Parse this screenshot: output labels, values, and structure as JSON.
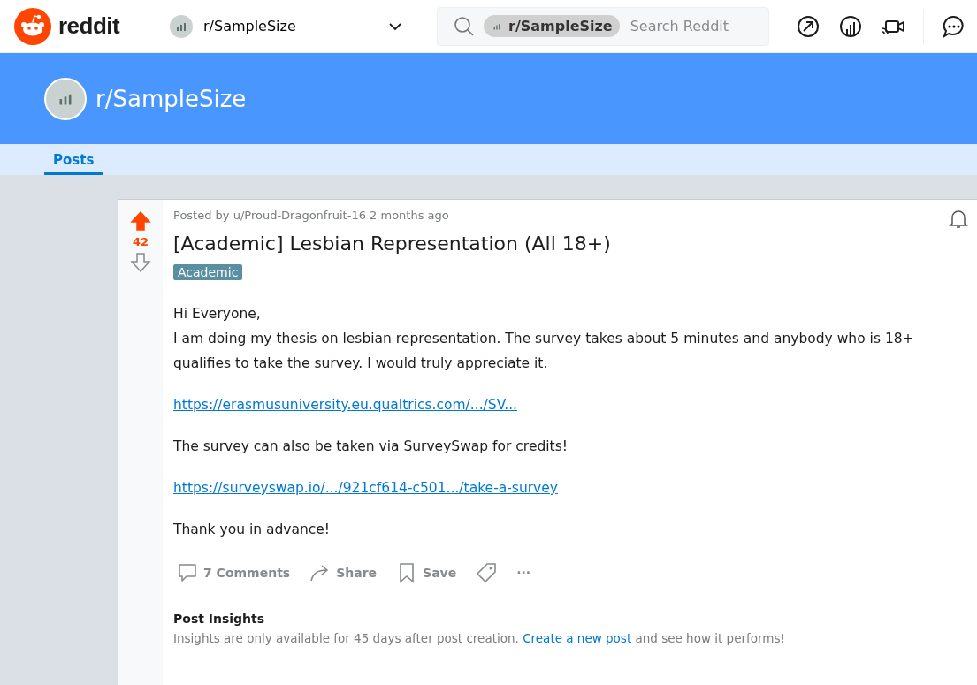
{
  "header": {
    "brand": "reddit",
    "community": "r/SampleSize",
    "search_chip": "r/SampleSize",
    "search_placeholder": "Search Reddit"
  },
  "banner": {
    "title": "r/SampleSize"
  },
  "tabs": [
    {
      "label": "Posts",
      "selected": true
    }
  ],
  "post": {
    "meta": "Posted by u/Proud-Dragonfruit-16 2 months ago",
    "score": "42",
    "upvoted": true,
    "title": "[Academic] Lesbian Representation (All 18+)",
    "flair": "Academic",
    "body": [
      {
        "kind": "text",
        "lines": [
          "Hi Everyone,",
          "I am doing my thesis on lesbian representation. The survey takes about 5 minutes and anybody who is 18+ qualifies to take the survey. I would truly appreciate it."
        ]
      },
      {
        "kind": "link",
        "lines": [
          "https://erasmusuniversity.eu.qualtrics.com/.../SV..."
        ]
      },
      {
        "kind": "text",
        "lines": [
          "The survey can also be taken via SurveySwap for credits!"
        ]
      },
      {
        "kind": "link",
        "lines": [
          "https://surveyswap.io/.../921cf614-c501.../take-a-survey"
        ]
      },
      {
        "kind": "text",
        "lines": [
          "Thank you in advance!"
        ]
      }
    ],
    "actions": [
      {
        "kind": "comments",
        "label": "7 Comments"
      },
      {
        "kind": "share",
        "label": "Share"
      },
      {
        "kind": "save",
        "label": "Save"
      },
      {
        "kind": "tag"
      },
      {
        "kind": "more",
        "label": "···"
      }
    ],
    "insights": {
      "title": "Post Insights",
      "text_before": "Insights are only available for 45 days after post creation. ",
      "link": "Create a new post",
      "text_after": " and see how it performs!"
    }
  }
}
